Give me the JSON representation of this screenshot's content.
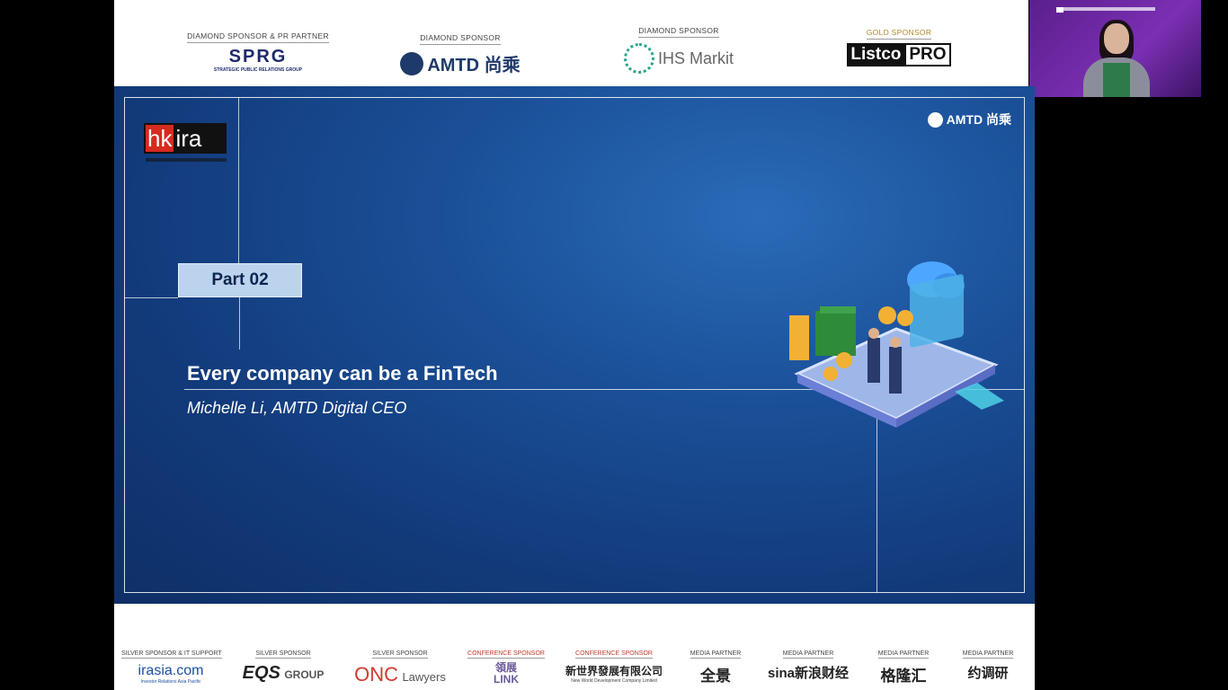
{
  "top_sponsors": [
    {
      "label": "Diamond Sponsor & PR Partner",
      "name": "SPRG",
      "sub": "STRATEGIC PUBLIC RELATIONS GROUP"
    },
    {
      "label": "Diamond Sponsor",
      "name": "AMTD 尚乘"
    },
    {
      "label": "Diamond Sponsor",
      "name": "IHS Markit"
    },
    {
      "label": "Gold Sponsor",
      "name_a": "Listco",
      "name_b": "PRO"
    }
  ],
  "slide": {
    "logo_hk": "hk",
    "logo_ira": "ira",
    "corner_logo": "AMTD 尚乘",
    "part_label": "Part 02",
    "title": "Every company can be a FinTech",
    "subtitle": "Michelle Li, AMTD Digital CEO"
  },
  "bottom_sponsors": [
    {
      "label": "Silver Sponsor & IT Support",
      "name": "irasia.com",
      "sub": "Investor Relations Asia Pacific"
    },
    {
      "label": "Silver Sponsor",
      "name": "EQS",
      "suffix": "GROUP"
    },
    {
      "label": "Silver Sponsor",
      "name": "ONC",
      "suffix": "Lawyers"
    },
    {
      "label": "Conference Sponsor",
      "name": "領展",
      "suffix": "LINK"
    },
    {
      "label": "Conference Sponsor",
      "name": "新世界發展有限公司",
      "sub": "New World Development Company Limited"
    },
    {
      "label": "Media Partner",
      "name": "全景"
    },
    {
      "label": "Media Partner",
      "name": "sina新浪财经"
    },
    {
      "label": "Media Partner",
      "name": "格隆汇"
    },
    {
      "label": "Media Partner",
      "name": "约调研"
    }
  ],
  "colors": {
    "slide_bg": "#1a4f97",
    "part_box": "#bcd3ee",
    "hk_red": "#d52b1e",
    "video_bg": "#7b2fb3"
  }
}
